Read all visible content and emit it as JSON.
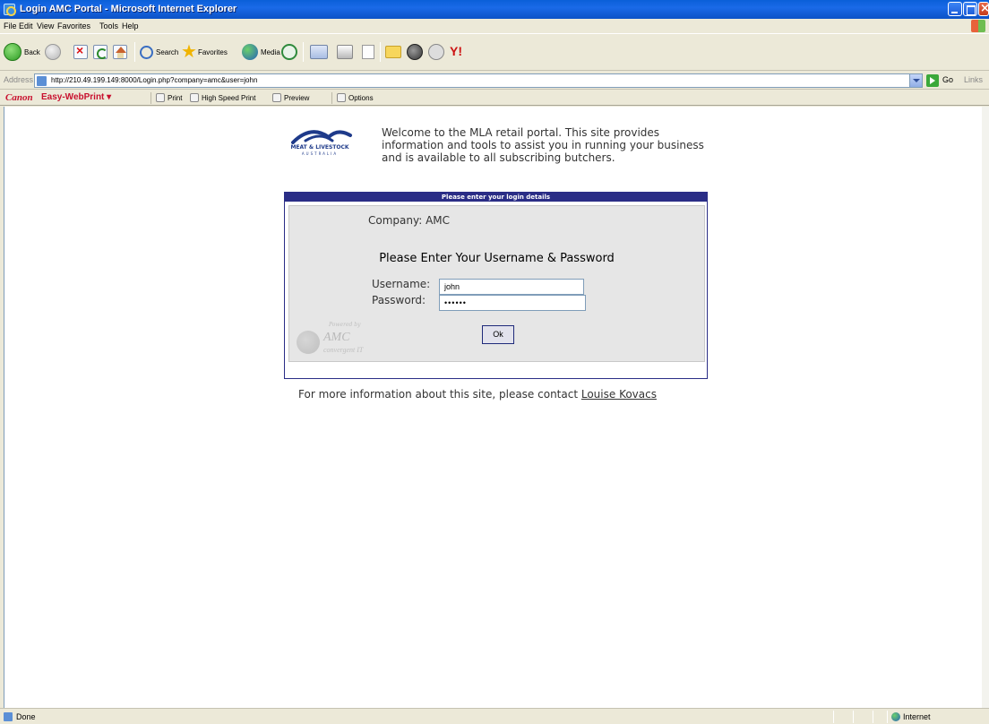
{
  "window": {
    "title": "Login AMC Portal - Microsoft Internet Explorer"
  },
  "menu": [
    "File",
    "Edit",
    "View",
    "Favorites",
    "Tools",
    "Help"
  ],
  "toolbar": {
    "back_label": "Back",
    "search_label": "Search",
    "favorites_label": "Favorites",
    "media_label": "Media"
  },
  "address": {
    "label": "Address",
    "url": "http://210.49.199.149:8000/Login.php?company=amc&user=john",
    "go_label": "Go",
    "links_label": "Links"
  },
  "canon": {
    "logo": "Canon",
    "product": "Easy-WebPrint",
    "dropdown_arrow": "▾",
    "print_label": "Print",
    "high_speed_label": "High Speed Print",
    "preview_label": "Preview",
    "options_label": "Options"
  },
  "page": {
    "logo_text": "MEAT & LIVESTOCK",
    "logo_subtext": "AUSTRALIA",
    "welcome": "Welcome to the MLA retail portal. This site provides information and tools to assist you in running your business and is available to all subscribing butchers.",
    "panel_header": "Please enter your login details",
    "company_label": "Company:",
    "company_value": "AMC",
    "prompt": "Please Enter Your Username & Password",
    "username_label": "Username:",
    "username_value": "john",
    "password_label": "Password:",
    "password_masked": "••••••",
    "ok_label": "Ok",
    "powered_by": "Powered by",
    "powered_amc": "AMC",
    "powered_convergent": "convergent IT",
    "footer_text": "For more information about this site, please contact",
    "footer_link": "Louise Kovacs"
  },
  "status": {
    "text": "Done",
    "zone": "Internet"
  }
}
